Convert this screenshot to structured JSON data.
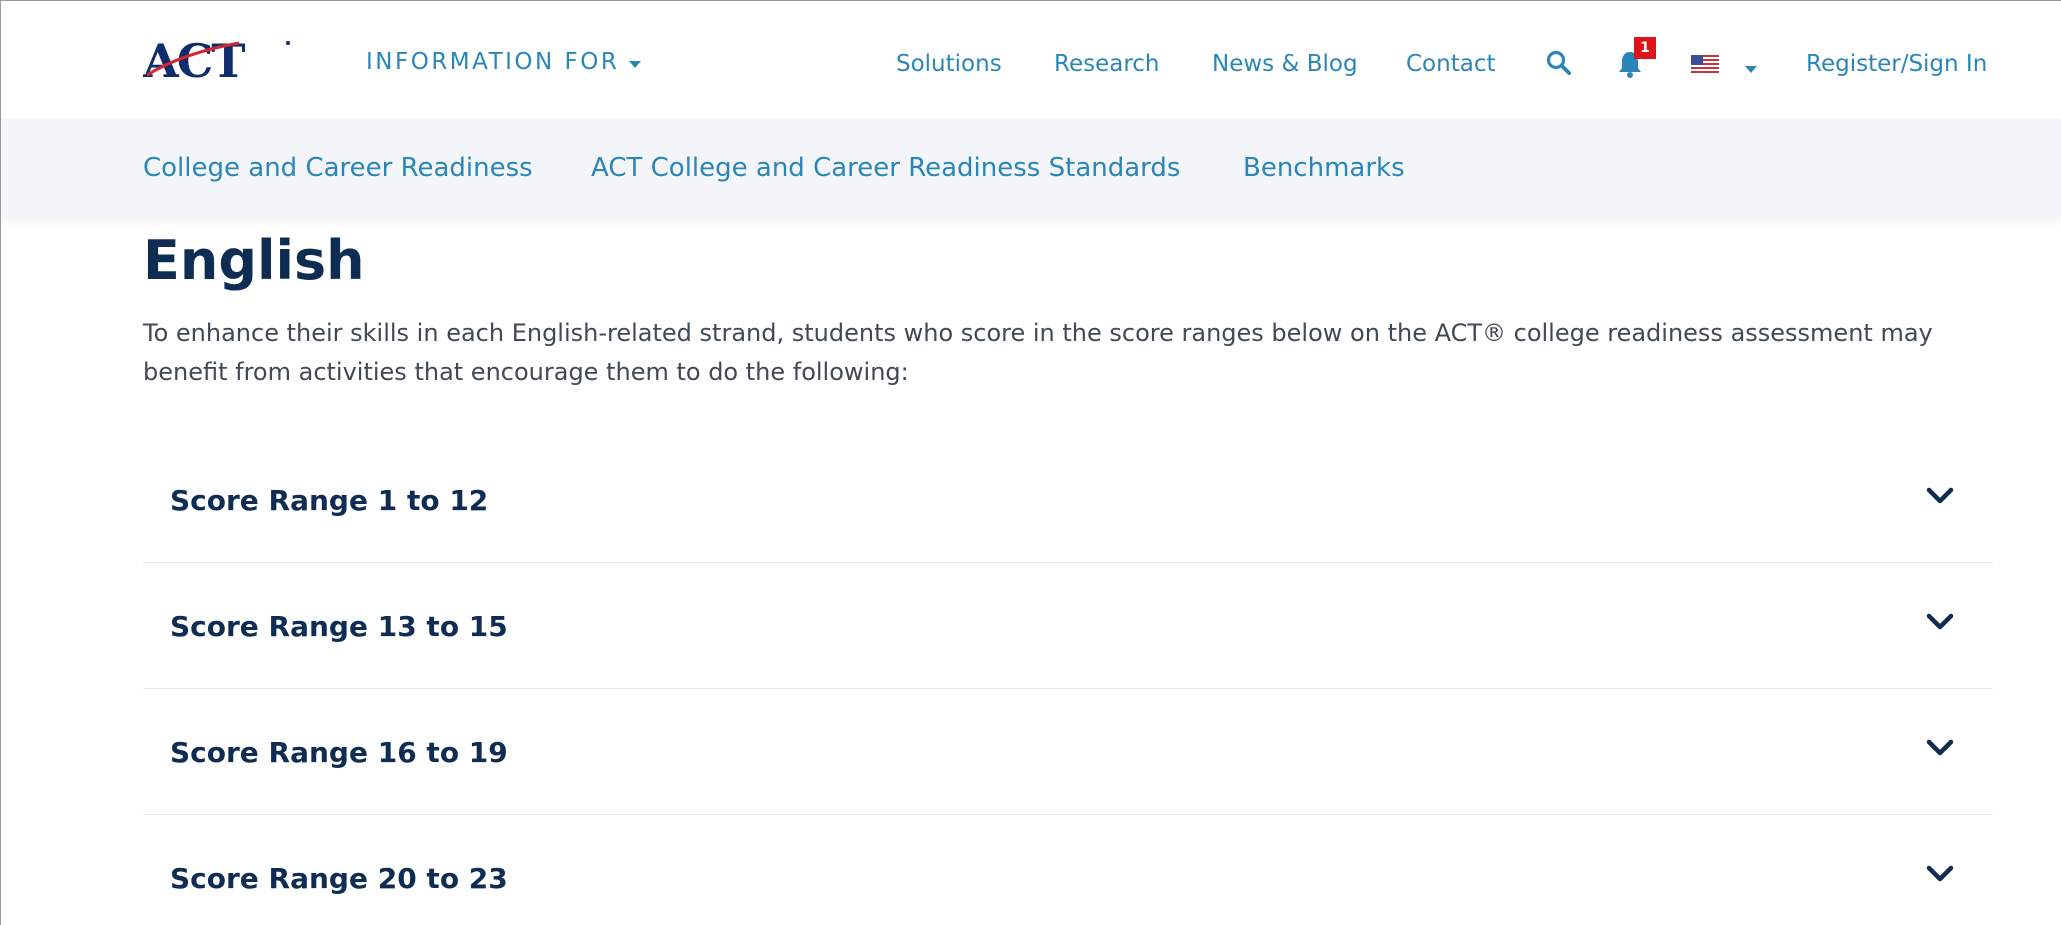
{
  "header": {
    "logo_text": "ACT",
    "info_for_label": "INFORMATION FOR",
    "nav_links": [
      "Solutions",
      "Research",
      "News & Blog",
      "Contact"
    ],
    "search_icon": "search-icon",
    "notification_icon": "bell-icon",
    "notification_count": "1",
    "locale_icon": "us-flag-icon",
    "register_label": "Register/Sign In"
  },
  "subnav": {
    "links": [
      "College and Career Readiness",
      "ACT College and Career Readiness Standards",
      "Benchmarks"
    ]
  },
  "main": {
    "title": "English",
    "intro": "To enhance their skills in each English-related strand, students who score in the score ranges below on the ACT® college readiness assessment may benefit from activities that encourage them to do the following:",
    "accordion": [
      {
        "label": "Score Range 1 to 12"
      },
      {
        "label": "Score Range 13 to 15"
      },
      {
        "label": "Score Range 16 to 19"
      },
      {
        "label": "Score Range 20 to 23"
      }
    ]
  },
  "colors": {
    "link": "#2b86b8",
    "heading": "#0f2d52",
    "body_text": "#3f4a55",
    "subnav_bg": "#f3f5f8",
    "logo_navy": "#0f2d6b",
    "logo_red": "#d3262f",
    "badge_red": "#e0121a"
  }
}
